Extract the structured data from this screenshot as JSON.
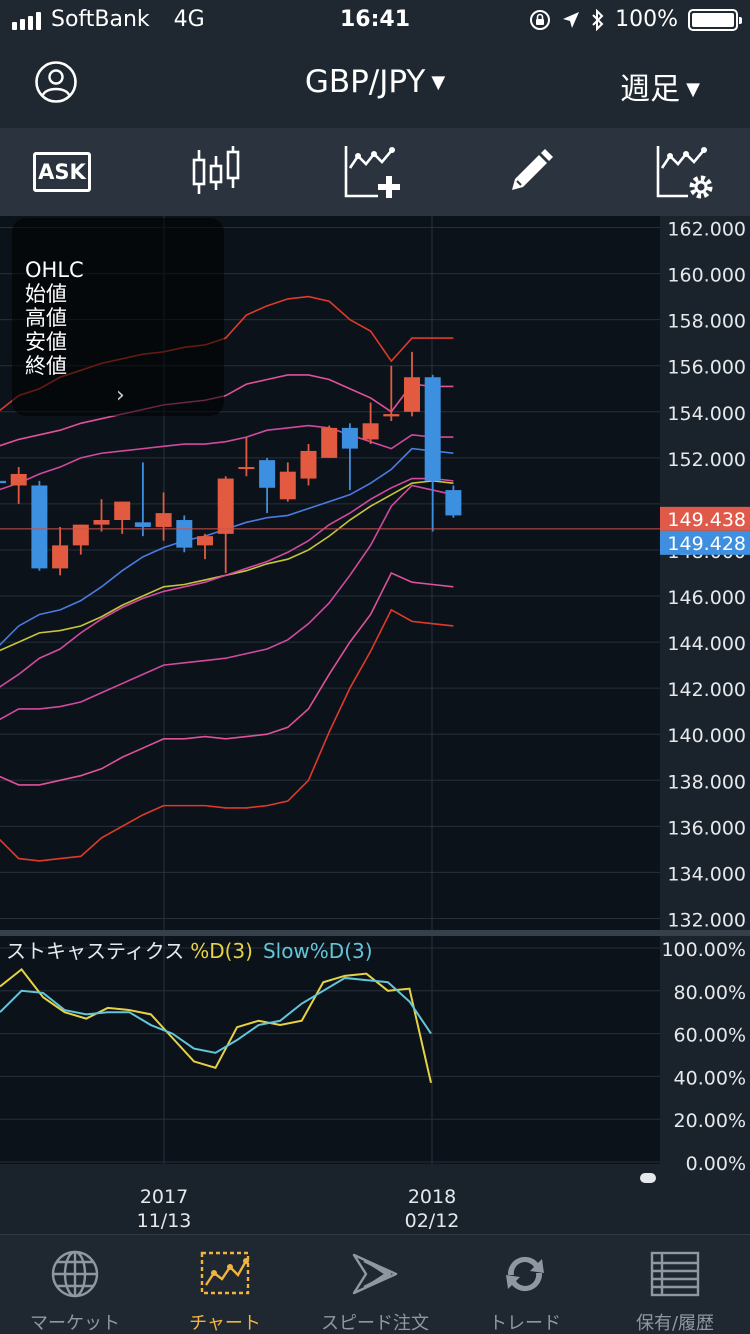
{
  "status_bar": {
    "carrier": "SoftBank",
    "network": "4G",
    "time": "16:41",
    "battery": "100%"
  },
  "nav": {
    "avatar_icon": "user-icon",
    "pair": "GBP/JPY",
    "period": "週足"
  },
  "toolbar": {
    "ask_label": "ASK",
    "icons": [
      "candlestick-icon",
      "add-indicator-icon",
      "pencil-icon",
      "chart-settings-icon"
    ]
  },
  "ohlc": {
    "title": "OHLC",
    "open": "始値",
    "high": "高値",
    "low": "安値",
    "close": "終値"
  },
  "chart_data": [
    {
      "type": "candlestick",
      "y_ticks": [
        "162.000",
        "160.000",
        "158.000",
        "156.000",
        "154.000",
        "152.000",
        "148.000",
        "146.000",
        "144.000",
        "142.000",
        "140.000",
        "138.000",
        "136.000",
        "134.000",
        "132.000"
      ],
      "ylim": [
        131.5,
        162.5
      ],
      "price_labels": {
        "bid": "149.438",
        "ask": "149.428"
      },
      "candles": [
        {
          "o": 151.0,
          "h": 151.9,
          "l": 150.2,
          "c": 150.9
        },
        {
          "o": 150.8,
          "h": 151.6,
          "l": 150.0,
          "c": 151.3
        },
        {
          "o": 150.8,
          "h": 151.0,
          "l": 147.1,
          "c": 147.2
        },
        {
          "o": 147.2,
          "h": 149.0,
          "l": 146.9,
          "c": 148.2
        },
        {
          "o": 148.2,
          "h": 149.1,
          "l": 147.8,
          "c": 149.1
        },
        {
          "o": 149.1,
          "h": 150.2,
          "l": 148.8,
          "c": 149.3
        },
        {
          "o": 149.3,
          "h": 150.0,
          "l": 148.7,
          "c": 150.1
        },
        {
          "o": 149.2,
          "h": 151.8,
          "l": 148.6,
          "c": 149.0
        },
        {
          "o": 149.0,
          "h": 150.5,
          "l": 148.4,
          "c": 149.6
        },
        {
          "o": 149.3,
          "h": 149.5,
          "l": 147.9,
          "c": 148.1
        },
        {
          "o": 148.2,
          "h": 148.7,
          "l": 147.6,
          "c": 148.6
        },
        {
          "o": 148.7,
          "h": 151.2,
          "l": 147.0,
          "c": 151.1
        },
        {
          "o": 151.6,
          "h": 152.9,
          "l": 151.2,
          "c": 151.6
        },
        {
          "o": 151.9,
          "h": 152.0,
          "l": 149.6,
          "c": 150.7
        },
        {
          "o": 150.2,
          "h": 151.8,
          "l": 150.1,
          "c": 151.4
        },
        {
          "o": 151.1,
          "h": 152.6,
          "l": 150.8,
          "c": 152.3
        },
        {
          "o": 152.0,
          "h": 153.4,
          "l": 152.0,
          "c": 153.3
        },
        {
          "o": 153.3,
          "h": 153.5,
          "l": 150.6,
          "c": 152.4
        },
        {
          "o": 152.8,
          "h": 154.4,
          "l": 152.6,
          "c": 153.5
        },
        {
          "o": 153.8,
          "h": 156.0,
          "l": 153.6,
          "c": 153.9
        },
        {
          "o": 154.0,
          "h": 156.6,
          "l": 153.8,
          "c": 155.5
        },
        {
          "o": 155.5,
          "h": 155.6,
          "l": 148.8,
          "c": 151.0
        },
        {
          "o": 150.6,
          "h": 150.8,
          "l": 149.4,
          "c": 149.5
        }
      ],
      "overlays": [
        {
          "color": "#e03a2b",
          "values": [
            154.0,
            154.7,
            155.0,
            155.5,
            155.8,
            156.1,
            156.3,
            156.5,
            156.6,
            156.8,
            156.9,
            157.2,
            158.2,
            158.6,
            158.9,
            159.0,
            158.8,
            158.0,
            157.5,
            156.2,
            157.2,
            157.2,
            157.2
          ]
        },
        {
          "color": "#e0519b",
          "values": [
            152.5,
            152.8,
            153.0,
            153.2,
            153.5,
            153.7,
            153.9,
            154.1,
            154.3,
            154.4,
            154.5,
            154.7,
            155.2,
            155.4,
            155.6,
            155.6,
            155.4,
            155.0,
            154.6,
            154.0,
            155.2,
            155.1,
            155.1
          ]
        },
        {
          "color": "#d14a9e",
          "values": [
            150.6,
            150.9,
            151.3,
            151.6,
            152.0,
            152.2,
            152.3,
            152.4,
            152.5,
            152.6,
            152.6,
            152.7,
            152.9,
            153.2,
            153.3,
            153.4,
            153.3,
            153.0,
            152.7,
            152.4,
            153.0,
            152.9,
            152.9
          ]
        },
        {
          "color": "#4a7be0",
          "values": [
            143.8,
            144.7,
            145.2,
            145.4,
            145.8,
            146.4,
            147.1,
            147.7,
            148.1,
            148.4,
            148.6,
            148.9,
            149.2,
            149.4,
            149.5,
            149.8,
            150.1,
            150.4,
            150.9,
            151.5,
            152.4,
            152.3,
            152.2
          ]
        },
        {
          "color": "#c8c43a",
          "values": [
            143.6,
            144.0,
            144.4,
            144.5,
            144.7,
            145.1,
            145.6,
            146.0,
            146.4,
            146.5,
            146.7,
            146.9,
            147.1,
            147.4,
            147.6,
            148.0,
            148.6,
            149.3,
            149.9,
            150.4,
            150.9,
            151.0,
            150.9
          ]
        },
        {
          "color": "#d14a9e",
          "values": [
            142.0,
            142.6,
            143.3,
            143.7,
            144.4,
            145.0,
            145.5,
            145.9,
            146.2,
            146.4,
            146.6,
            146.9,
            147.2,
            147.5,
            147.9,
            148.4,
            149.1,
            149.6,
            150.2,
            150.7,
            151.1,
            151.1,
            151.0
          ]
        },
        {
          "color": "#d14a9e",
          "values": [
            140.6,
            141.1,
            141.1,
            141.2,
            141.4,
            141.8,
            142.2,
            142.6,
            143.0,
            143.1,
            143.2,
            143.3,
            143.5,
            143.7,
            144.1,
            144.8,
            145.7,
            146.9,
            148.2,
            149.9,
            150.8,
            150.6,
            150.4
          ]
        },
        {
          "color": "#e0519b",
          "values": [
            138.2,
            137.8,
            137.8,
            138.0,
            138.2,
            138.5,
            139.0,
            139.4,
            139.8,
            139.8,
            139.9,
            139.8,
            139.9,
            140.0,
            140.3,
            141.1,
            142.6,
            144.0,
            145.2,
            147.0,
            146.6,
            146.5,
            146.4
          ]
        },
        {
          "color": "#e03a2b",
          "values": [
            135.5,
            134.6,
            134.5,
            134.6,
            134.7,
            135.5,
            136.0,
            136.5,
            136.9,
            136.9,
            136.9,
            136.8,
            136.8,
            136.9,
            137.1,
            138.0,
            140.1,
            142.0,
            143.6,
            145.4,
            144.9,
            144.8,
            144.7
          ]
        }
      ]
    },
    {
      "type": "line",
      "title": "ストキャスティクス",
      "series": [
        {
          "name": "%D(3)",
          "color": "#e7d244",
          "values": [
            82.0,
            90.0,
            77.0,
            70.0,
            67.0,
            72.0,
            71.0,
            69.0,
            58.0,
            47.0,
            44.0,
            63.0,
            66.0,
            64.0,
            66.0,
            84.0,
            87.0,
            88.0,
            80.0,
            81.0,
            37.0
          ]
        },
        {
          "name": "Slow%D(3)",
          "color": "#63c5d9",
          "values": [
            70.0,
            80.0,
            79.0,
            71.0,
            69.0,
            70.0,
            70.0,
            64.0,
            60.0,
            53.0,
            51.0,
            57.0,
            64.0,
            66.0,
            74.0,
            80.0,
            86.0,
            85.0,
            84.0,
            75.0,
            60.0
          ]
        }
      ],
      "y_ticks": [
        "100.00%",
        "80.00%",
        "60.00%",
        "40.00%",
        "20.00%",
        "0.00%"
      ],
      "ylim": [
        0,
        100
      ]
    }
  ],
  "x_axis": [
    {
      "year": "2017",
      "date": "11/13"
    },
    {
      "year": "2018",
      "date": "02/12"
    }
  ],
  "tabs": [
    {
      "label": "マーケット",
      "icon": "globe-icon",
      "active": false
    },
    {
      "label": "チャート",
      "icon": "chart-icon",
      "active": true
    },
    {
      "label": "スピード注文",
      "icon": "speed-order-icon",
      "active": false
    },
    {
      "label": "トレード",
      "icon": "trade-icon",
      "active": false
    },
    {
      "label": "保有/履歴",
      "icon": "history-icon",
      "active": false
    }
  ]
}
